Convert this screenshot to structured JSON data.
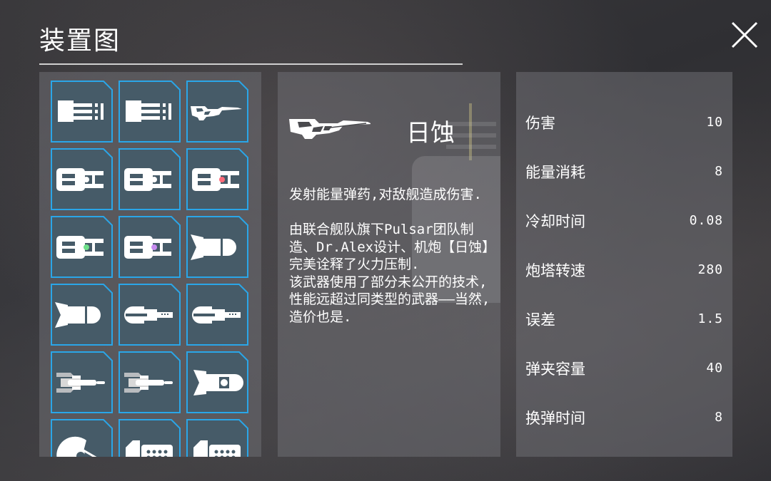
{
  "header": {
    "title": "装置图"
  },
  "colors": {
    "tile_border": "#2aa6e8",
    "tile_fill": "#465b68",
    "icon_white": "#ffffff",
    "panel_bg": "#6e6e73"
  },
  "weapon_grid": {
    "tiles": [
      {
        "icon": "triple-barrel-cannon-icon"
      },
      {
        "icon": "triple-barrel-cannon-icon"
      },
      {
        "icon": "eclipse-gun-icon"
      },
      {
        "icon": "energy-turret-icon",
        "core_color": "#ffffff"
      },
      {
        "icon": "energy-turret-icon",
        "core_color": "#ffffff"
      },
      {
        "icon": "energy-turret-icon",
        "core_color": "#ff6b7a"
      },
      {
        "icon": "energy-turret-icon",
        "core_color": "#6fe08a"
      },
      {
        "icon": "energy-turret-icon",
        "core_color": "#c88cf0"
      },
      {
        "icon": "missile-launcher-icon"
      },
      {
        "icon": "missile-launcher-icon"
      },
      {
        "icon": "rail-cannon-icon"
      },
      {
        "icon": "rail-cannon-icon"
      },
      {
        "icon": "twin-engine-gun-icon"
      },
      {
        "icon": "twin-engine-gun-icon"
      },
      {
        "icon": "heavy-missile-icon"
      },
      {
        "icon": "dish-emitter-icon"
      },
      {
        "icon": "cluster-pod-icon"
      },
      {
        "icon": "cluster-pod-icon"
      }
    ]
  },
  "detail": {
    "icon": "eclipse-gun-icon",
    "name": "日蚀",
    "description": "发射能量弹药,对敌舰造成伤害.\n\n由联合舰队旗下Pulsar团队制造、Dr.Alex设计、机炮【日蚀】完美诠释了火力压制.\n该武器使用了部分未公开的技术,\n性能远超过同类型的武器——当然,造价也是."
  },
  "stats": [
    {
      "label": "伤害",
      "value": "10"
    },
    {
      "label": "能量消耗",
      "value": "8"
    },
    {
      "label": "冷却时间",
      "value": "0.08"
    },
    {
      "label": "炮塔转速",
      "value": "280"
    },
    {
      "label": "误差",
      "value": "1.5"
    },
    {
      "label": "弹夹容量",
      "value": "40"
    },
    {
      "label": "换弹时间",
      "value": "8"
    }
  ]
}
